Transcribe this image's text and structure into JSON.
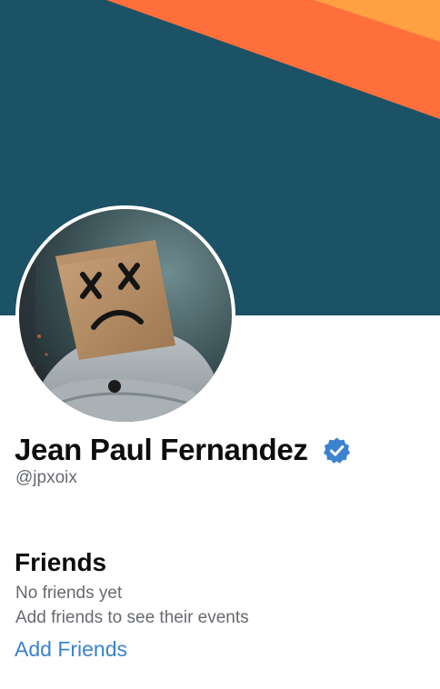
{
  "profile": {
    "name": "Jean Paul Fernandez",
    "handle": "@jpxoix",
    "verified_icon": "verified-badge-icon",
    "avatar_description": "person with paper bag over head"
  },
  "friends": {
    "title": "Friends",
    "empty_title": "No friends yet",
    "empty_subtitle": "Add friends to see their events",
    "add_link": "Add Friends"
  },
  "colors": {
    "banner_background": "#1b5266",
    "banner_stripe_primary": "#fe6f3b",
    "banner_stripe_secondary": "#ffa042",
    "link": "#3b82cf",
    "verified": "#3b82cf",
    "muted_text": "#666a70"
  }
}
